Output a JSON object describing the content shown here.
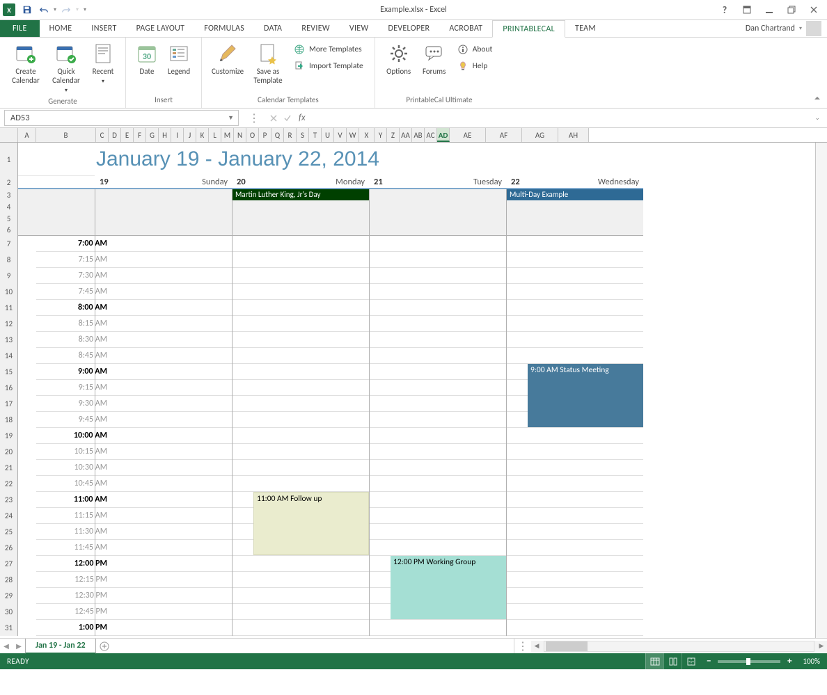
{
  "titlebar": {
    "app_icon": "X",
    "title": "Example.xlsx - Excel"
  },
  "qat": {
    "save": "",
    "undo": "",
    "redo": "",
    "custom": ""
  },
  "wincontrols": {
    "help": "?",
    "options": "",
    "min": "",
    "restore": "",
    "close": ""
  },
  "tabs": {
    "file": "FILE",
    "items": [
      "HOME",
      "INSERT",
      "PAGE LAYOUT",
      "FORMULAS",
      "DATA",
      "REVIEW",
      "VIEW",
      "DEVELOPER",
      "ACROBAT",
      "PRINTABLECAL",
      "TEAM"
    ],
    "active": "PRINTABLECAL",
    "user": "Dan Chartrand"
  },
  "ribbon": {
    "groups": [
      {
        "label": "Generate",
        "big": [
          {
            "name": "create-calendar",
            "label": "Create\nCalendar"
          },
          {
            "name": "quick-calendar",
            "label": "Quick\nCalendar",
            "dd": true
          },
          {
            "name": "recent",
            "label": "Recent",
            "dd": true
          }
        ]
      },
      {
        "label": "Insert",
        "big": [
          {
            "name": "date",
            "label": "Date"
          },
          {
            "name": "legend",
            "label": "Legend"
          }
        ]
      },
      {
        "label": "Calendar Templates",
        "big": [
          {
            "name": "customize",
            "label": "Customize"
          },
          {
            "name": "save-template",
            "label": "Save as\nTemplate"
          }
        ],
        "small": [
          {
            "name": "more-templates",
            "label": "More Templates"
          },
          {
            "name": "import-template",
            "label": "Import Template"
          }
        ]
      },
      {
        "label": "PrintableCal Ultimate",
        "big": [
          {
            "name": "options",
            "label": "Options"
          },
          {
            "name": "forums",
            "label": "Forums"
          }
        ],
        "small": [
          {
            "name": "about",
            "label": "About"
          },
          {
            "name": "help",
            "label": "Help"
          }
        ]
      }
    ]
  },
  "formulabar": {
    "cell_ref": "AD53",
    "fx": "fx"
  },
  "columns": {
    "letters": [
      "A",
      "B",
      "C",
      "D",
      "E",
      "F",
      "G",
      "H",
      "I",
      "J",
      "K",
      "L",
      "M",
      "N",
      "O",
      "P",
      "Q",
      "R",
      "S",
      "T",
      "U",
      "V",
      "W",
      "X",
      "Y",
      "Z",
      "AA",
      "AB",
      "AC",
      "AD",
      "AE",
      "AF",
      "AG",
      "AH"
    ],
    "widths": [
      26,
      86,
      18,
      18,
      18,
      18,
      18,
      18,
      18,
      18,
      18,
      18,
      18,
      18,
      18,
      18,
      18,
      18,
      18,
      18,
      18,
      18,
      18,
      22,
      18,
      18,
      18,
      18,
      18,
      18,
      52,
      52,
      52,
      44
    ],
    "active": "AD"
  },
  "row_headers": [
    "1",
    "2",
    "3",
    "4",
    "5",
    "6",
    "7",
    "8",
    "9",
    "10",
    "11",
    "12",
    "13",
    "14",
    "15",
    "16",
    "17",
    "18",
    "19",
    "20",
    "21",
    "22",
    "23",
    "24",
    "25",
    "26",
    "27",
    "28",
    "29",
    "30",
    "31"
  ],
  "calendar": {
    "title": "January 19 - January 22, 2014",
    "days": [
      {
        "num": "19",
        "name": "Sunday"
      },
      {
        "num": "20",
        "name": "Monday"
      },
      {
        "num": "21",
        "name": "Tuesday"
      },
      {
        "num": "22",
        "name": "Wednesday"
      }
    ],
    "allday": [
      {
        "day": 1,
        "label": "Martin Luther King, Jr's Day",
        "cls": "ev-dark"
      },
      {
        "day": 3,
        "label": "Multi-Day Example",
        "cls": "ev-blue"
      }
    ],
    "timeslots": [
      {
        "t": "7:00 AM",
        "bold": true
      },
      {
        "t": "7:15 AM"
      },
      {
        "t": "7:30 AM"
      },
      {
        "t": "7:45 AM"
      },
      {
        "t": "8:00 AM",
        "bold": true
      },
      {
        "t": "8:15 AM"
      },
      {
        "t": "8:30 AM"
      },
      {
        "t": "8:45 AM"
      },
      {
        "t": "9:00 AM",
        "bold": true
      },
      {
        "t": "9:15 AM"
      },
      {
        "t": "9:30 AM"
      },
      {
        "t": "9:45 AM"
      },
      {
        "t": "10:00 AM",
        "bold": true
      },
      {
        "t": "10:15 AM"
      },
      {
        "t": "10:30 AM"
      },
      {
        "t": "10:45 AM"
      },
      {
        "t": "11:00 AM",
        "bold": true
      },
      {
        "t": "11:15 AM"
      },
      {
        "t": "11:30 AM"
      },
      {
        "t": "11:45 AM"
      },
      {
        "t": "12:00 PM",
        "bold": true
      },
      {
        "t": "12:15 PM"
      },
      {
        "t": "12:30 PM"
      },
      {
        "t": "12:45 PM"
      },
      {
        "t": "1:00 PM",
        "bold": true
      }
    ],
    "events": [
      {
        "day": 3,
        "start": 8,
        "span": 4,
        "label": "9:00 AM  Status Meeting",
        "cls": "ev-steel",
        "pad": 30
      },
      {
        "day": 1,
        "start": 16,
        "span": 4,
        "label": "11:00 AM  Follow up",
        "cls": "ev-beige",
        "pad": 30
      },
      {
        "day": 2,
        "start": 20,
        "span": 4,
        "label": "12:00 PM  Working Group",
        "cls": "ev-mint",
        "pad": 30
      }
    ]
  },
  "sheettabs": {
    "active": "Jan 19 - Jan 22"
  },
  "statusbar": {
    "status": "READY",
    "zoom": "100%"
  }
}
